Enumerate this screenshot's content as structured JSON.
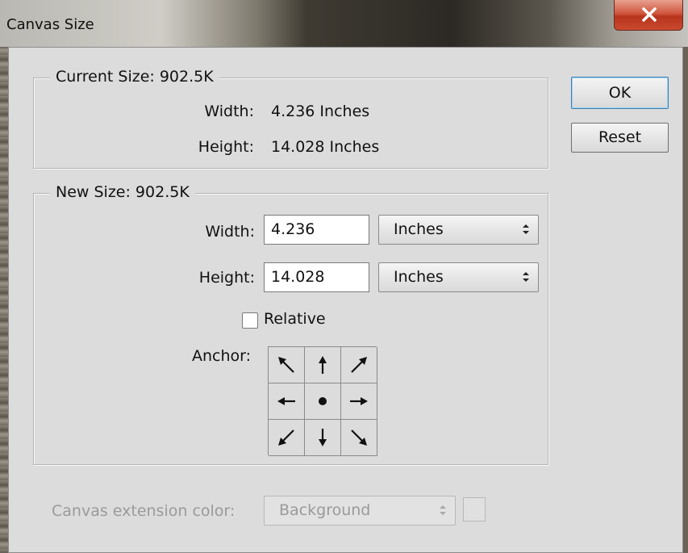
{
  "window": {
    "title": "Canvas Size"
  },
  "buttons": {
    "ok": "OK",
    "reset": "Reset"
  },
  "current_size": {
    "legend": "Current Size: 902.5K",
    "width_label": "Width:",
    "width_value": "4.236 Inches",
    "height_label": "Height:",
    "height_value": "14.028 Inches"
  },
  "new_size": {
    "legend": "New Size: 902.5K",
    "width_label": "Width:",
    "width_value": "4.236",
    "width_unit": "Inches",
    "height_label": "Height:",
    "height_value": "14.028",
    "height_unit": "Inches",
    "relative_label": "Relative",
    "relative_checked": false,
    "anchor_label": "Anchor:",
    "anchor_cells": [
      "arrow-up-left",
      "arrow-up",
      "arrow-up-right",
      "arrow-left",
      "center-dot",
      "arrow-right",
      "arrow-down-left",
      "arrow-down",
      "arrow-down-right"
    ]
  },
  "extension": {
    "label": "Canvas extension color:",
    "value": "Background",
    "enabled": false
  },
  "colors": {
    "dialog_bg": "#dcdcdc",
    "close_button": "#c94a2f",
    "ok_border": "#3c7fb1"
  }
}
